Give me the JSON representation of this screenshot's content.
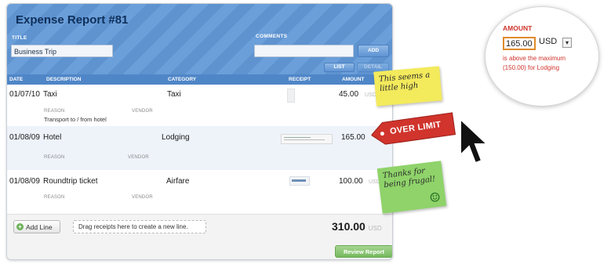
{
  "report": {
    "title": "Expense Report #81",
    "title_label": "TITLE",
    "title_value": "Business Trip",
    "comments_label": "COMMENTS",
    "comments_value": "",
    "add_button": "ADD",
    "list_button": "LIST",
    "detail_button": "DETAIL"
  },
  "columns": [
    "DATE",
    "DESCRIPTION",
    "CATEGORY",
    "RECEIPT",
    "AMOUNT"
  ],
  "rows": [
    {
      "date": "01/07/10",
      "description": "Taxi",
      "category": "Taxi",
      "amount": "45.00",
      "currency": "USD",
      "reason_label": "REASON",
      "vendor_label": "VENDOR",
      "reason": "Transport to / from hotel"
    },
    {
      "date": "01/08/09",
      "description": "Hotel",
      "category": "Lodging",
      "amount": "165.00",
      "currency": "USD",
      "reason_label": "REASON",
      "vendor_label": "VENDOR",
      "reason": ""
    },
    {
      "date": "01/08/09",
      "description": "Roundtrip ticket",
      "category": "Airfare",
      "amount": "100.00",
      "currency": "USD",
      "reason_label": "REASON",
      "vendor_label": "VENDOR",
      "reason": ""
    }
  ],
  "footer": {
    "add_line": "Add Line",
    "drop_hint": "Drag receipts here to create a new line.",
    "total": "310.00",
    "total_currency": "USD",
    "review_button": "Review Report"
  },
  "annotations": {
    "note_yellow": "This seems a little high",
    "over_limit": "OVER LIMIT",
    "note_green": "Thanks for being frugal!",
    "smiley": "☺",
    "bubble_label": "AMOUNT",
    "bubble_amount": "165.00",
    "bubble_currency": "USD",
    "bubble_message": "is above the maximum (150.00) for Lodging"
  },
  "colors": {
    "header_blue": "#6b9fd9",
    "column_bar": "#4f86c7",
    "alert_red": "#d0342c",
    "note_yellow": "#f3ea5c",
    "note_green": "#8fd36a",
    "review_green": "#74b95c"
  },
  "icons": {
    "add_line": "plus-circle-icon",
    "cursor": "arrow-cursor-icon",
    "receipt": "receipt-thumbnail-icon"
  }
}
